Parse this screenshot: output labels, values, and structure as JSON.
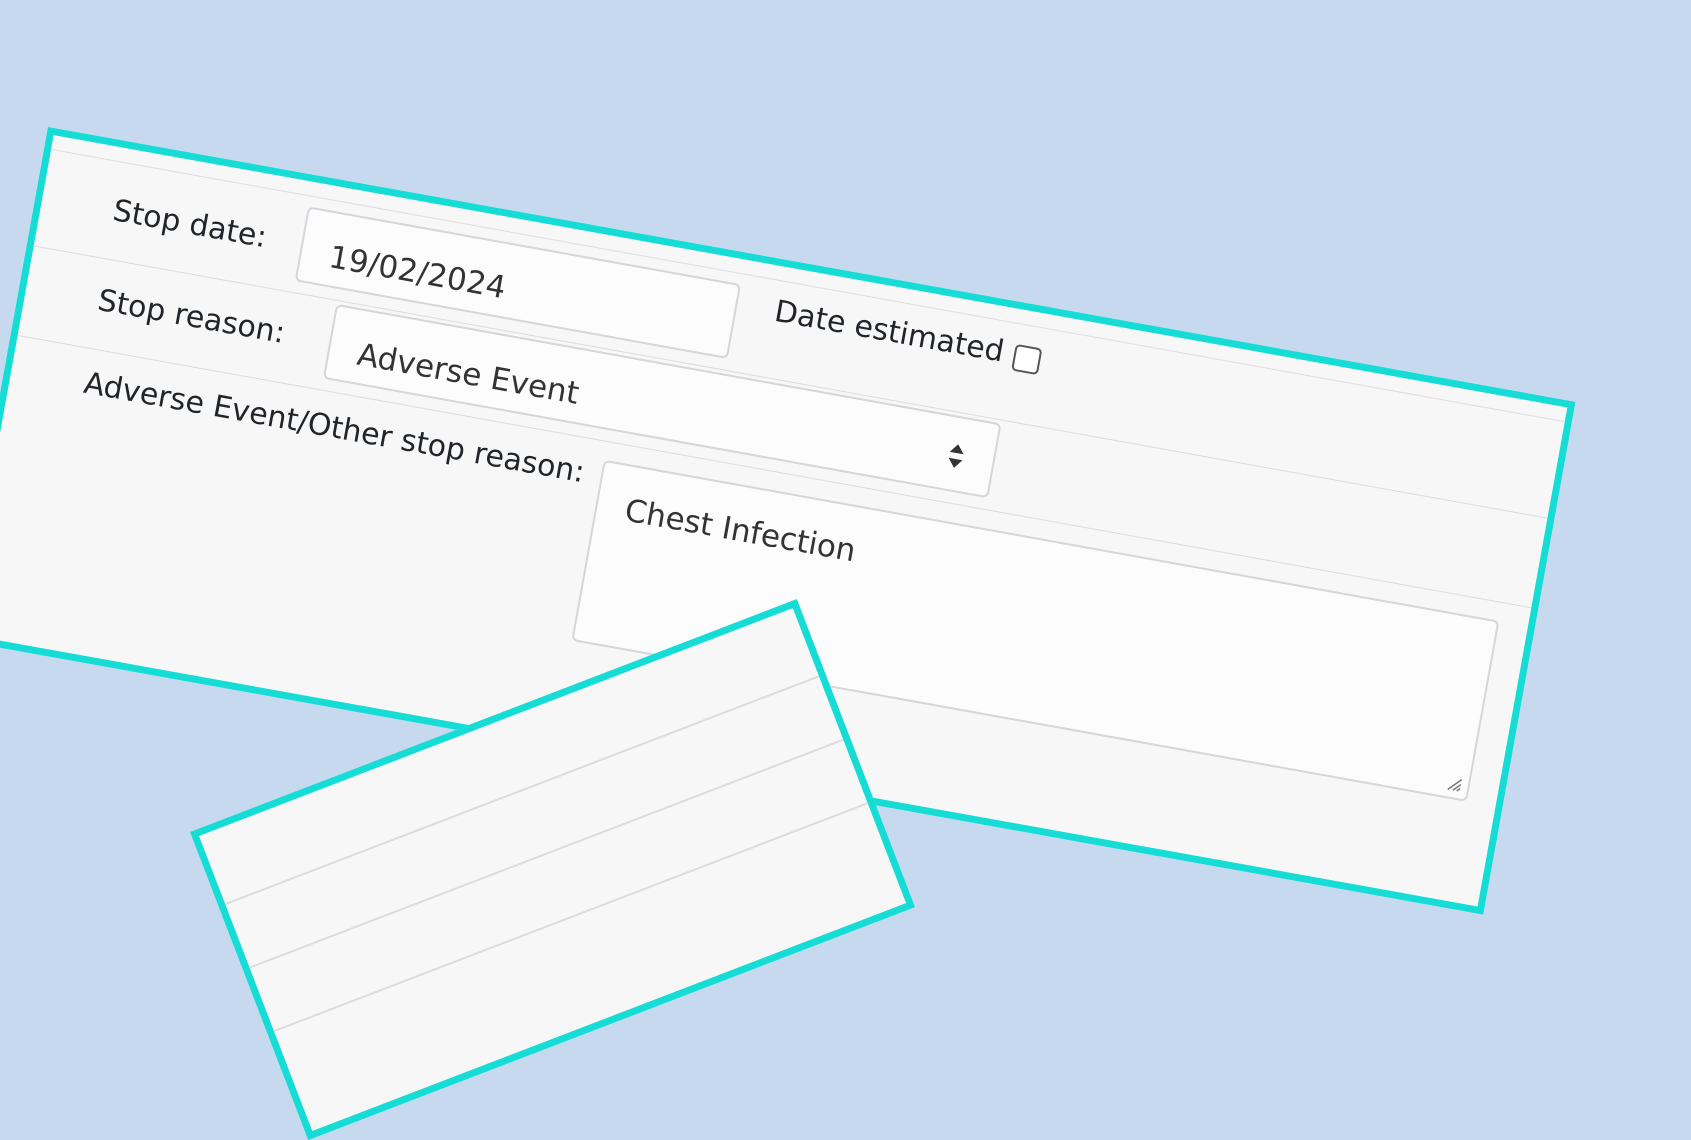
{
  "form": {
    "stop_date_label": "Stop date:",
    "stop_date_value": "19/02/2024",
    "date_estimated_label": "Date estimated",
    "date_estimated_checked": false,
    "stop_reason_label": "Stop reason:",
    "stop_reason_value": "Adverse Event",
    "other_stop_reason_label": "Adverse Event/Other stop reason:",
    "other_stop_reason_value": "Chest Infection"
  },
  "icons": {
    "select_arrows": "sort-arrows-icon",
    "resize_grip": "resize-grip-icon"
  },
  "colors": {
    "background": "#c6d9ef",
    "frame_border": "#16dcd6",
    "panel_background": "#f7f7f7"
  }
}
